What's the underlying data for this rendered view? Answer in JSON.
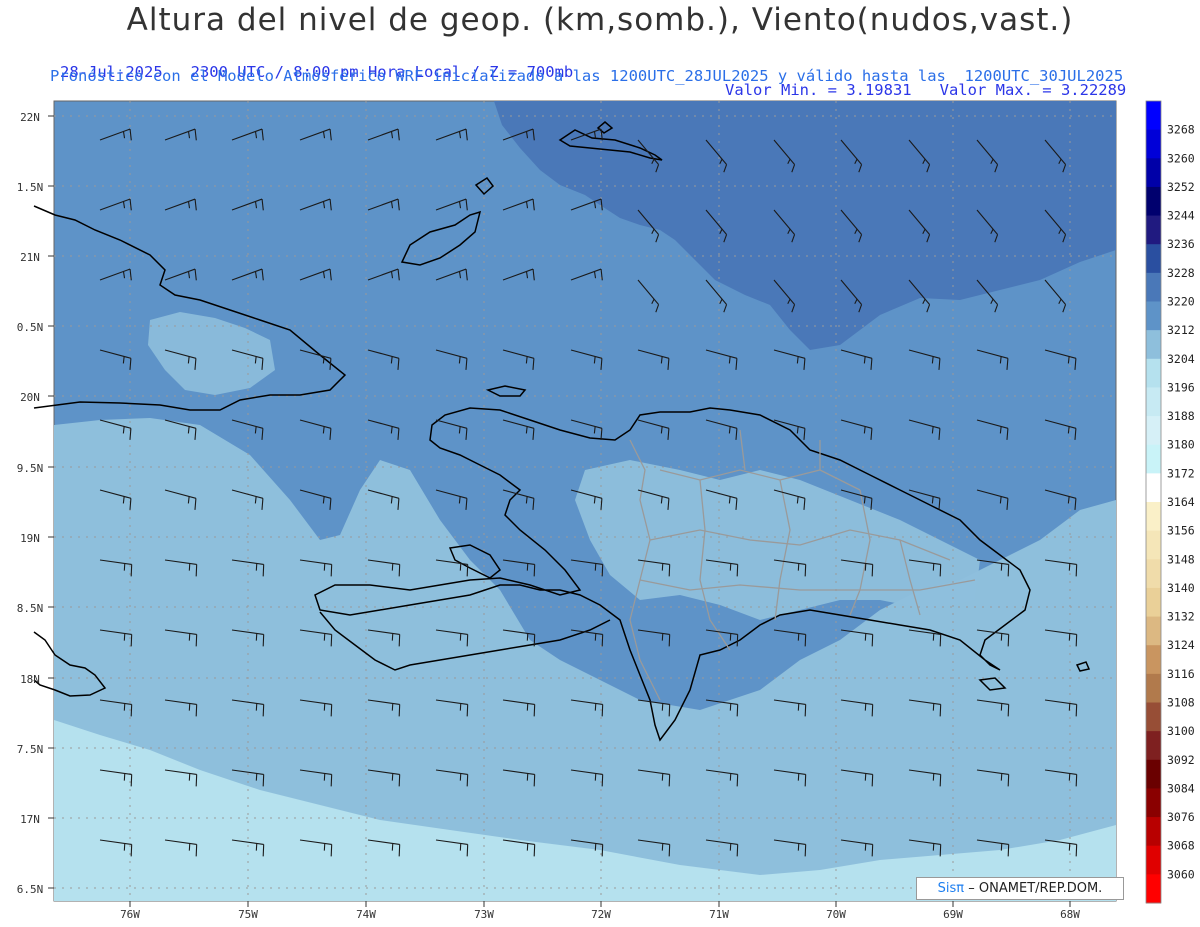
{
  "header": {
    "title": "Altura del nivel de geop. (km,somb.), Viento(nudos,vast.)",
    "datetime_line": "28-Jul-2025   2300 UTC / 8:00 pm Hora Local / Z = 700mb",
    "minmax_line": "Valor Min. = 3.19831   Valor Max. = 3.22289",
    "model_line": "Pronóstico con el Modelo Atmosférico WRF inicializado a las 1200UTC_28JUL2025 y válido hasta las  1200UTC_30JUL2025"
  },
  "lat_labels": [
    "22N",
    "1.5N",
    "21N",
    "0.5N",
    "20N",
    "9.5N",
    "19N",
    "8.5N",
    "18N",
    "7.5N",
    "17N",
    "6.5N"
  ],
  "lon_labels": [
    "76W",
    "75W",
    "74W",
    "73W",
    "72W",
    "71W",
    "70W",
    "69W",
    "68W"
  ],
  "colorbar": {
    "labels": [
      "3268",
      "3260",
      "3252",
      "3244",
      "3236",
      "3228",
      "3220",
      "3212",
      "3204",
      "3196",
      "3188",
      "3180",
      "3172",
      "3164",
      "3156",
      "3148",
      "3140",
      "3132",
      "3124",
      "3116",
      "3108",
      "3100",
      "3092",
      "3084",
      "3076",
      "3068",
      "3060"
    ],
    "colors": [
      "#0000ff",
      "#0000d8",
      "#0000a8",
      "#00006e",
      "#201a80",
      "#2a4fa0",
      "#4a78b8",
      "#5e93c8",
      "#8ebfdc",
      "#b5e1ee",
      "#c7eaf3",
      "#d6f0f7",
      "#c9f3f8",
      "#ffffff",
      "#faf0c8",
      "#f5e6b8",
      "#f0dcaa",
      "#ead098",
      "#dcb882",
      "#c99560",
      "#b17a4c",
      "#974e36",
      "#7e2020",
      "#6a0000",
      "#8a0000",
      "#b80000",
      "#e00000",
      "#ff0000"
    ]
  },
  "colors": {
    "shade_low": "#b5e1ee",
    "shade_mid": "#8ebfdc",
    "shade_high": "#5e93c8",
    "shade_top": "#4a78b8",
    "coast": "#000000",
    "borders": "#9a9a9a",
    "barbs": "#1a1a1a"
  },
  "credit": {
    "brand": "Sisπ",
    "text": "– ONAMET/REP.DOM."
  }
}
